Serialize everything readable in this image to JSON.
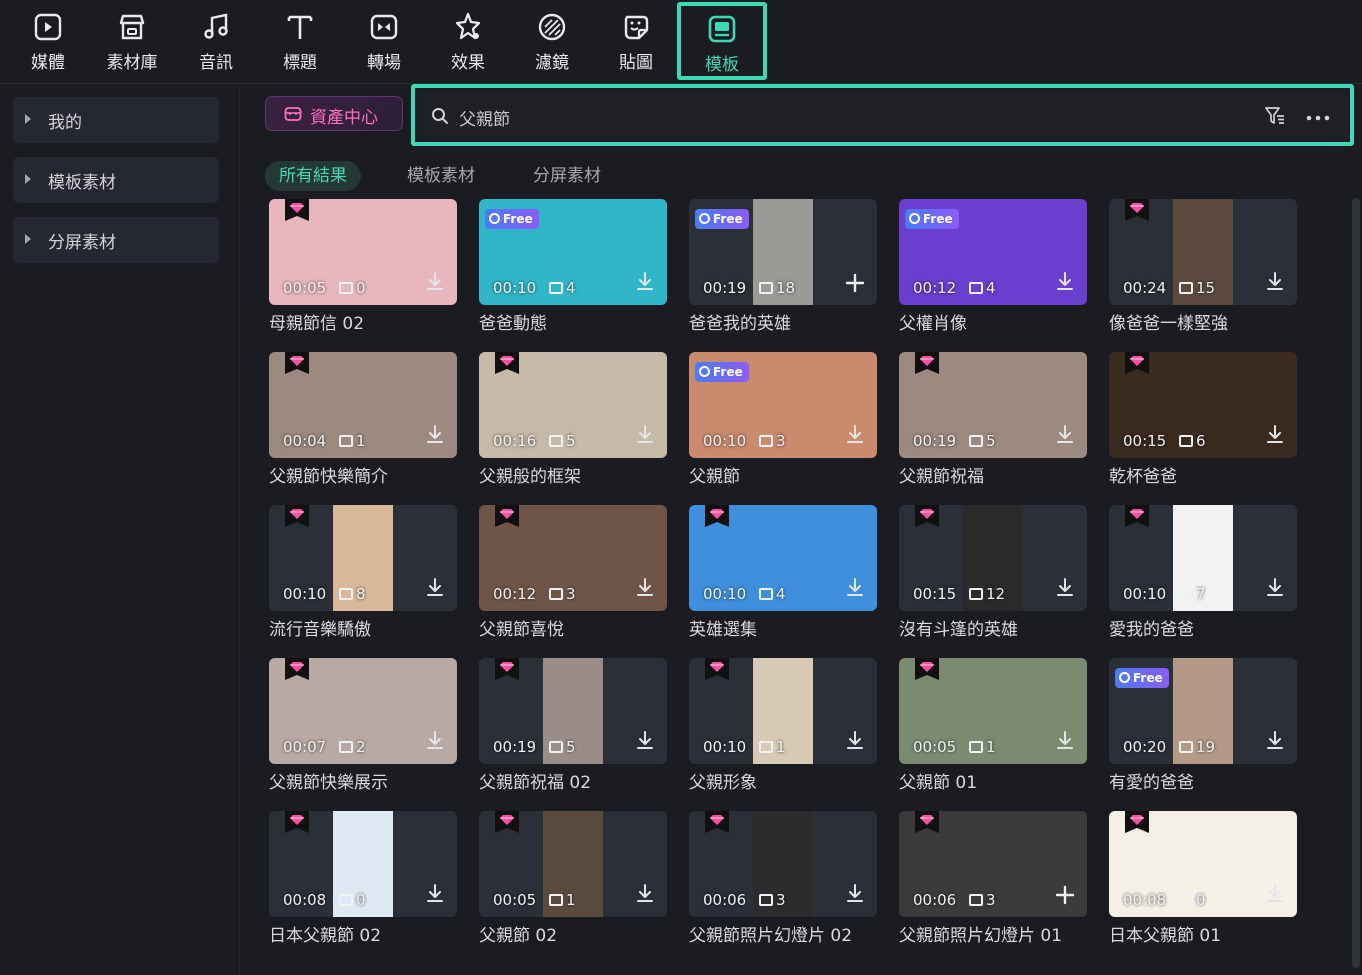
{
  "toolbar": {
    "items": [
      {
        "label": "媒體",
        "icon": "media-icon"
      },
      {
        "label": "素材庫",
        "icon": "store-icon"
      },
      {
        "label": "音訊",
        "icon": "music-note-icon"
      },
      {
        "label": "標題",
        "icon": "title-t-icon"
      },
      {
        "label": "轉場",
        "icon": "transition-icon"
      },
      {
        "label": "效果",
        "icon": "effects-star-icon"
      },
      {
        "label": "濾鏡",
        "icon": "filter-icon"
      },
      {
        "label": "貼圖",
        "icon": "sticker-icon"
      },
      {
        "label": "模板",
        "icon": "template-icon"
      }
    ],
    "active": "模板"
  },
  "sidebar": {
    "items": [
      {
        "label": "我的"
      },
      {
        "label": "模板素材"
      },
      {
        "label": "分屏素材"
      }
    ]
  },
  "asset_center": {
    "label": "資產中心"
  },
  "search": {
    "value": "父親節"
  },
  "tabs": [
    {
      "label": "所有結果",
      "active": true
    },
    {
      "label": "模板素材",
      "active": false
    },
    {
      "label": "分屏素材",
      "active": false
    }
  ],
  "colors": {
    "accent": "#3cd9b7",
    "premium": "#ff4fa3",
    "free": "#5b6cf5"
  },
  "templates": [
    {
      "title": "母親節信 02",
      "duration": "00:05",
      "clips": "0",
      "badge": "premium",
      "action": "download",
      "art": "#e8b7be"
    },
    {
      "title": "爸爸動態",
      "duration": "00:10",
      "clips": "4",
      "badge": "free",
      "action": "download",
      "art": "#2fb7c9"
    },
    {
      "title": "爸爸我的英雄",
      "duration": "00:19",
      "clips": "18",
      "badge": "free",
      "action": "add",
      "art": "#9a9a96"
    },
    {
      "title": "父權肖像",
      "duration": "00:12",
      "clips": "4",
      "badge": "free",
      "action": "download",
      "art": "#6a3fd0"
    },
    {
      "title": "像爸爸一樣堅強",
      "duration": "00:24",
      "clips": "15",
      "badge": "premium",
      "action": "download",
      "art": "#5c4a3e"
    },
    {
      "title": "父親節快樂簡介",
      "duration": "00:04",
      "clips": "1",
      "badge": "premium",
      "action": "download",
      "art": "#9c8a80"
    },
    {
      "title": "父親般的框架",
      "duration": "00:16",
      "clips": "5",
      "badge": "premium",
      "action": "download",
      "art": "#c7b9a8"
    },
    {
      "title": "父親節",
      "duration": "00:10",
      "clips": "3",
      "badge": "free",
      "action": "download",
      "art": "#c98a6e"
    },
    {
      "title": "父親節祝福",
      "duration": "00:19",
      "clips": "5",
      "badge": "premium",
      "action": "download",
      "art": "#9c8a80"
    },
    {
      "title": "乾杯爸爸",
      "duration": "00:15",
      "clips": "6",
      "badge": "premium",
      "action": "download",
      "art": "#3a2a1f"
    },
    {
      "title": "流行音樂驕傲",
      "duration": "00:10",
      "clips": "8",
      "badge": "premium",
      "action": "download",
      "art": "#d9b89a"
    },
    {
      "title": "父親節喜悅",
      "duration": "00:12",
      "clips": "3",
      "badge": "premium",
      "action": "download",
      "art": "#6e5547"
    },
    {
      "title": "英雄選集",
      "duration": "00:10",
      "clips": "4",
      "badge": "premium",
      "action": "download",
      "art": "#3f8fdc"
    },
    {
      "title": "沒有斗篷的英雄",
      "duration": "00:15",
      "clips": "12",
      "badge": "premium",
      "action": "download",
      "art": "#2a2a2a"
    },
    {
      "title": "愛我的爸爸",
      "duration": "00:10",
      "clips": "7",
      "badge": "premium",
      "action": "download",
      "art": "#f2f2f2"
    },
    {
      "title": "父親節快樂展示",
      "duration": "00:07",
      "clips": "2",
      "badge": "premium",
      "action": "download",
      "art": "#b9a9a4"
    },
    {
      "title": "父親節祝福 02",
      "duration": "00:19",
      "clips": "5",
      "badge": "premium",
      "action": "download",
      "art": "#9a8d88"
    },
    {
      "title": "父親形象",
      "duration": "00:10",
      "clips": "1",
      "badge": "premium",
      "action": "download",
      "art": "#d8c9b5"
    },
    {
      "title": "父親節 01",
      "duration": "00:05",
      "clips": "1",
      "badge": "premium",
      "action": "download",
      "art": "#7a8b6f"
    },
    {
      "title": "有愛的爸爸",
      "duration": "00:20",
      "clips": "19",
      "badge": "free",
      "action": "download",
      "art": "#b49a86"
    },
    {
      "title": "日本父親節 02",
      "duration": "00:08",
      "clips": "0",
      "badge": "premium",
      "action": "download",
      "art": "#dfe9f3"
    },
    {
      "title": "父親節 02",
      "duration": "00:05",
      "clips": "1",
      "badge": "premium",
      "action": "download",
      "art": "#5a4a3e"
    },
    {
      "title": "父親節照片幻燈片 02",
      "duration": "00:06",
      "clips": "3",
      "badge": "premium",
      "action": "download",
      "art": "#2c2c2c"
    },
    {
      "title": "父親節照片幻燈片 01",
      "duration": "00:06",
      "clips": "3",
      "badge": "premium",
      "action": "add",
      "art": "#3b3b3b"
    },
    {
      "title": "日本父親節 01",
      "duration": "00:08",
      "clips": "0",
      "badge": "premium",
      "action": "download",
      "art": "#f4f0e6"
    }
  ]
}
